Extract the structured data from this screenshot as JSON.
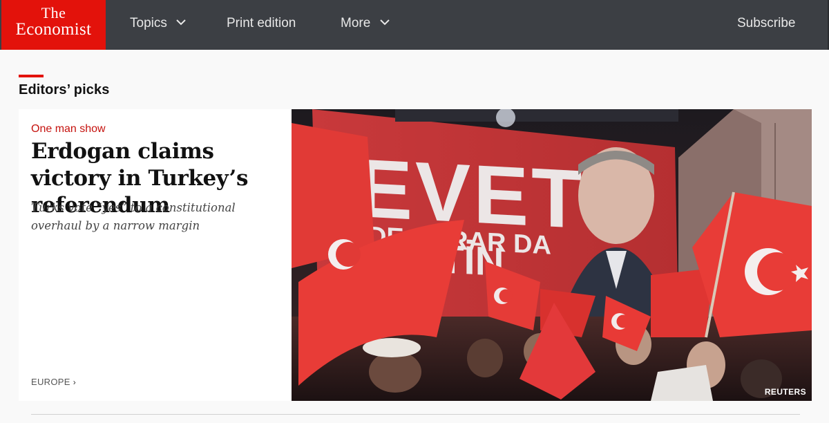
{
  "brand": {
    "line1": "The",
    "line2": "Economist"
  },
  "nav": {
    "topics": "Topics",
    "print_edition": "Print edition",
    "more": "More",
    "subscribe": "Subscribe"
  },
  "section": {
    "title": "Editors’ picks"
  },
  "article": {
    "flytitle": "One man show",
    "headline": "Erdogan claims victory in Turkey’s referendum",
    "rubric": "Turks vote “yes” to a constitutional overhaul by a narrow margin",
    "section_link": "EUROPE",
    "image": {
      "banner_line1": "EVET",
      "banner_line2": "DE KARAR DA",
      "banner_line3": "ETTİN",
      "credit": "REUTERS"
    }
  },
  "colors": {
    "brand_red": "#e3120b",
    "nav_bg": "#3c3f44",
    "flytitle_red": "#c5120e"
  }
}
